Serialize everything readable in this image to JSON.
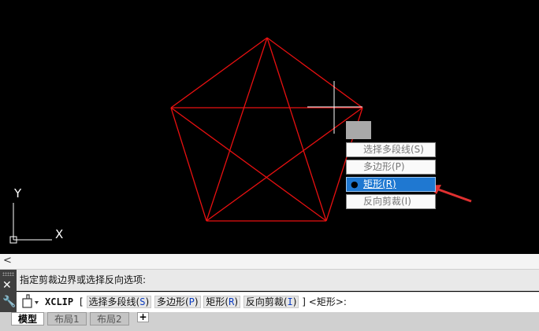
{
  "drawing": {
    "line_color": "#e81010",
    "axis_y_label": "Y",
    "axis_x_label": "X"
  },
  "context_menu": {
    "items": [
      {
        "label": "选择多段线(S)",
        "selected": false
      },
      {
        "label": "多边形(P)",
        "selected": false
      },
      {
        "label": "矩形(R)",
        "selected": true
      },
      {
        "label": "反向剪裁(I)",
        "selected": false
      }
    ],
    "selected_color": "#1f78d1",
    "bullet": "●"
  },
  "collapse_bar": {
    "icon": "chevron-left-icon",
    "glyph": "<"
  },
  "command": {
    "history_text": "指定剪裁边界或选择反向选项:",
    "command_name": "XCLIP",
    "bracket_open": "[",
    "options": [
      {
        "text": "选择多段线(",
        "key": "S",
        "close": ")"
      },
      {
        "text": "多边形(",
        "key": "P",
        "close": ")"
      },
      {
        "text": "矩形(",
        "key": "R",
        "close": ")"
      },
      {
        "text": "反向剪裁(",
        "key": "I",
        "close": ")"
      }
    ],
    "tail": "] <矩形>:",
    "gutter_close": "✕",
    "gutter_wrench": "🔧"
  },
  "layout_tabs": {
    "tabs": [
      "模型",
      "布局1",
      "布局2"
    ],
    "active": 0,
    "add_label": "+"
  }
}
